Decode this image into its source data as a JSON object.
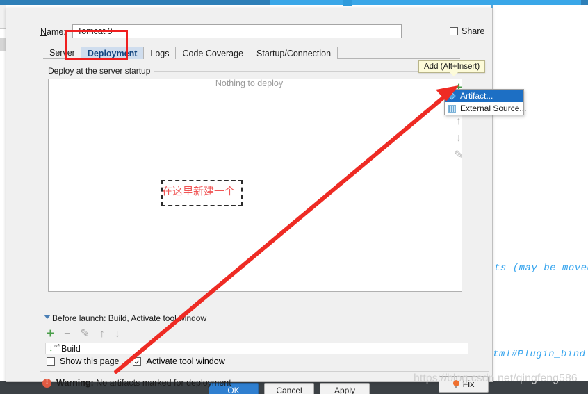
{
  "ide_background": {
    "code_line_1": "ts (may be moved",
    "code_line_2": "tml#Plugin_bind"
  },
  "dialog": {
    "name_label_prefix": "N",
    "name_label_rest": "ame:",
    "name_value": "Tomcat 9",
    "share_label_prefix": "S",
    "share_label_rest": "hare",
    "share_checked": false,
    "tabs": [
      {
        "label": "Server",
        "active": false
      },
      {
        "label": "Deployment",
        "active": true
      },
      {
        "label": "Logs",
        "active": false
      },
      {
        "label": "Code Coverage",
        "active": false
      },
      {
        "label": "Startup/Connection",
        "active": false
      }
    ],
    "group_title": "Deploy at the server startup",
    "empty_state": "Nothing to deploy",
    "vtoolbar": {
      "add": "+",
      "remove": "−",
      "move_up": "↑",
      "move_down": "↓",
      "edit": "✎"
    },
    "tooltip": "Add (Alt+Insert)",
    "menu": [
      {
        "label": "Artifact...",
        "icon": "artifact-diamond-icon",
        "selected": true
      },
      {
        "label": "External Source...",
        "icon": "external-source-icon",
        "selected": false
      }
    ],
    "before_launch": {
      "title_prefix": "B",
      "title_rest": "efore launch: Build, Activate tool window",
      "toolbar": {
        "add": "+",
        "remove": "−",
        "edit": "✎",
        "move_up": "↑",
        "move_down": "↓"
      },
      "items": [
        {
          "label": "Build"
        }
      ],
      "show_this_page_label": "Show this page",
      "show_this_page_checked": false,
      "activate_tool_window_label": "Activate tool window",
      "activate_tool_window_checked": true
    },
    "warning": {
      "prefix": "Warning:",
      "message": "No artifacts marked for deployment"
    },
    "fix_button": "Fix",
    "footer_buttons": [
      {
        "label": "OK",
        "primary": true
      },
      {
        "label": "Cancel",
        "primary": false
      },
      {
        "label": "Apply",
        "primary": false
      }
    ]
  },
  "annotations": {
    "chinese_note": "在这里新建一个",
    "highlight_color": "#f01f1f",
    "arrow_color": "#ee2b24"
  },
  "watermark": "https://blog.csdn.net/qingfeng586"
}
